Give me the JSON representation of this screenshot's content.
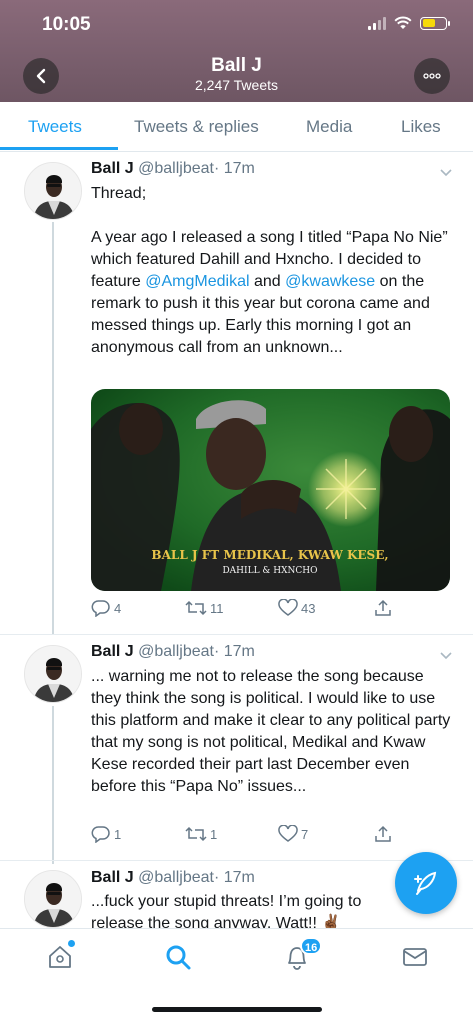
{
  "status_bar": {
    "time": "10:05"
  },
  "header": {
    "title": "Ball J",
    "subtitle": "2,247 Tweets"
  },
  "tabs": [
    {
      "label": "Tweets",
      "active": true
    },
    {
      "label": "Tweets & replies",
      "active": false
    },
    {
      "label": "Media",
      "active": false
    },
    {
      "label": "Likes",
      "active": false
    }
  ],
  "tweets": [
    {
      "name": "Ball J",
      "handle": "@balljbeat",
      "time": "· 17m",
      "text_intro": "Thread;",
      "text_1": "A year ago I released a song I titled “Papa No Nie” which featured Dahill and Hxncho. I decided to feature ",
      "mention_1": "@AmgMedikal",
      "text_2": " and ",
      "mention_2": "@kwawkese",
      "text_3": " on the remark to push it this year but corona came and messed things up. Early this morning I got an anonymous call from an unknown...",
      "media": {
        "line1": "BALL J FT MEDIKAL, KWAW KESE,",
        "line2": "DAHILL & HXNCHO"
      },
      "replies": "4",
      "retweets": "11",
      "likes": "43"
    },
    {
      "name": "Ball J",
      "handle": "@balljbeat",
      "time": "· 17m",
      "text": "... warning me not to release the song because they think the song is political. I would like to use this platform and make it clear to any political party that my song is not political, Medikal and Kwaw Kese recorded their part last December even before this “Papa No” issues...",
      "replies": "1",
      "retweets": "1",
      "likes": "7"
    },
    {
      "name": "Ball J",
      "handle": "@balljbeat",
      "time": "· 17m",
      "text": "...fuck your stupid threats! I’m going to release the song anyway. Watt!! ✌🏾"
    }
  ],
  "bottom_nav": {
    "notifications_count": "16"
  },
  "colors": {
    "accent": "#1da1f2",
    "header_bg": "#7d6170",
    "muted": "#657786"
  }
}
